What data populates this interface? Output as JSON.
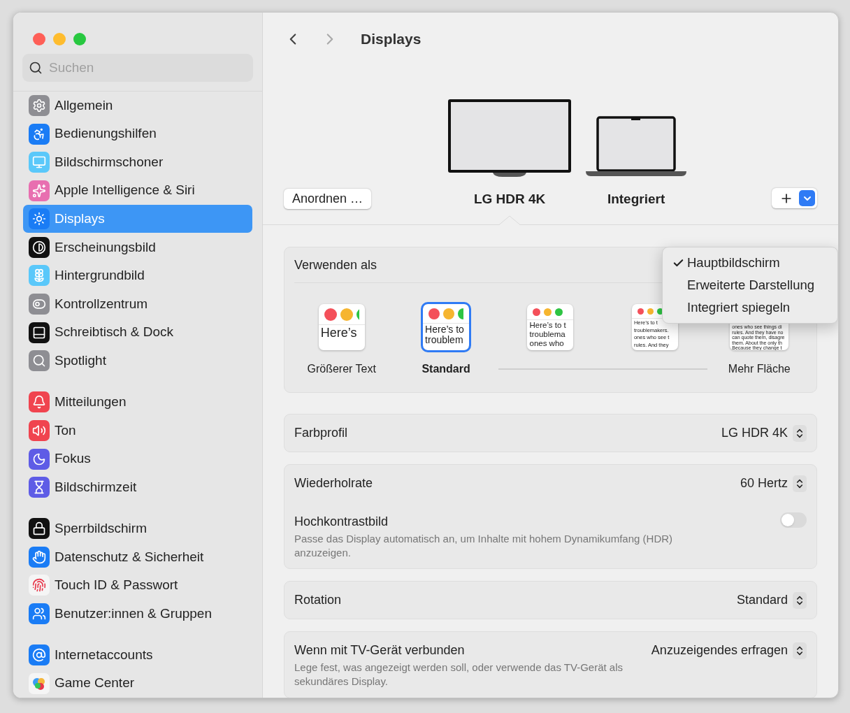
{
  "window": {
    "title": "Displays"
  },
  "search": {
    "placeholder": "Suchen"
  },
  "sidebar": {
    "groups": [
      {
        "items": [
          {
            "label": "Allgemein",
            "selected": false
          },
          {
            "label": "Bedienungshilfen",
            "selected": false
          },
          {
            "label": "Bildschirmschoner",
            "selected": false
          },
          {
            "label": "Apple Intelligence & Siri",
            "selected": false
          },
          {
            "label": "Displays",
            "selected": true
          },
          {
            "label": "Erscheinungsbild",
            "selected": false
          },
          {
            "label": "Hintergrundbild",
            "selected": false
          },
          {
            "label": "Kontrollzentrum",
            "selected": false
          },
          {
            "label": "Schreibtisch & Dock",
            "selected": false
          },
          {
            "label": "Spotlight",
            "selected": false
          }
        ]
      },
      {
        "items": [
          {
            "label": "Mitteilungen",
            "selected": false
          },
          {
            "label": "Ton",
            "selected": false
          },
          {
            "label": "Fokus",
            "selected": false
          },
          {
            "label": "Bildschirmzeit",
            "selected": false
          }
        ]
      },
      {
        "items": [
          {
            "label": "Sperrbildschirm",
            "selected": false
          },
          {
            "label": "Datenschutz & Sicherheit",
            "selected": false
          },
          {
            "label": "Touch ID & Passwort",
            "selected": false
          },
          {
            "label": "Benutzer:innen & Gruppen",
            "selected": false
          }
        ]
      },
      {
        "items": [
          {
            "label": "Internetaccounts",
            "selected": false
          },
          {
            "label": "Game Center",
            "selected": false
          }
        ]
      }
    ]
  },
  "arrange_button": "Anordnen …",
  "displays": [
    {
      "name": "LG HDR 4K",
      "kind": "monitor",
      "selected": true
    },
    {
      "name": "Integriert",
      "kind": "laptop",
      "selected": false
    }
  ],
  "use_as": {
    "label": "Verwenden als",
    "menu": [
      {
        "label": "Hauptbildschirm",
        "checked": true
      },
      {
        "label": "Erweiterte Darstellung",
        "checked": false
      },
      {
        "label": "Integriert spiegeln",
        "checked": false
      }
    ],
    "resolutions": [
      {
        "label": "Größerer Text",
        "selected": false,
        "window_buttons": true,
        "lines": [
          "Here’s"
        ]
      },
      {
        "label": "Standard",
        "selected": true,
        "window_buttons": true,
        "lines": [
          "Here’s to",
          "troublem"
        ]
      },
      {
        "selected": false,
        "window_buttons": true,
        "lines": [
          "Here’s to t",
          "troublema",
          "ones who"
        ]
      },
      {
        "selected": false,
        "window_buttons": true,
        "lines": [
          "Here’s to t",
          "troublemakers.",
          "ones who see t",
          "rules. And they"
        ]
      },
      {
        "label": "Mehr Fläche",
        "selected": false,
        "window_buttons": false,
        "lines": [
          "ones who see things di",
          "rules. And they have no",
          "can quote them, disagre",
          "them. About the only th",
          "Because they change t"
        ]
      }
    ]
  },
  "settings": [
    {
      "rows": [
        {
          "kind": "popup",
          "label": "Farbprofil",
          "value": "LG HDR 4K"
        }
      ]
    },
    {
      "rows": [
        {
          "kind": "popup",
          "label": "Wiederholrate",
          "value": "60 Hertz"
        },
        {
          "kind": "toggle",
          "label": "Hochkontrastbild",
          "on": false,
          "description": "Passe das Display automatisch an, um Inhalte mit hohem Dynamikumfang (HDR) anzuzeigen."
        }
      ]
    },
    {
      "rows": [
        {
          "kind": "popup",
          "label": "Rotation",
          "value": "Standard"
        }
      ]
    },
    {
      "rows": [
        {
          "kind": "popup",
          "label": "Wenn mit TV-Gerät verbunden",
          "value": "Anzuzeigendes erfragen",
          "description": "Lege fest, was angezeigt werden soll, oder verwende das TV-Gerät als sekundäres Display."
        }
      ]
    }
  ]
}
